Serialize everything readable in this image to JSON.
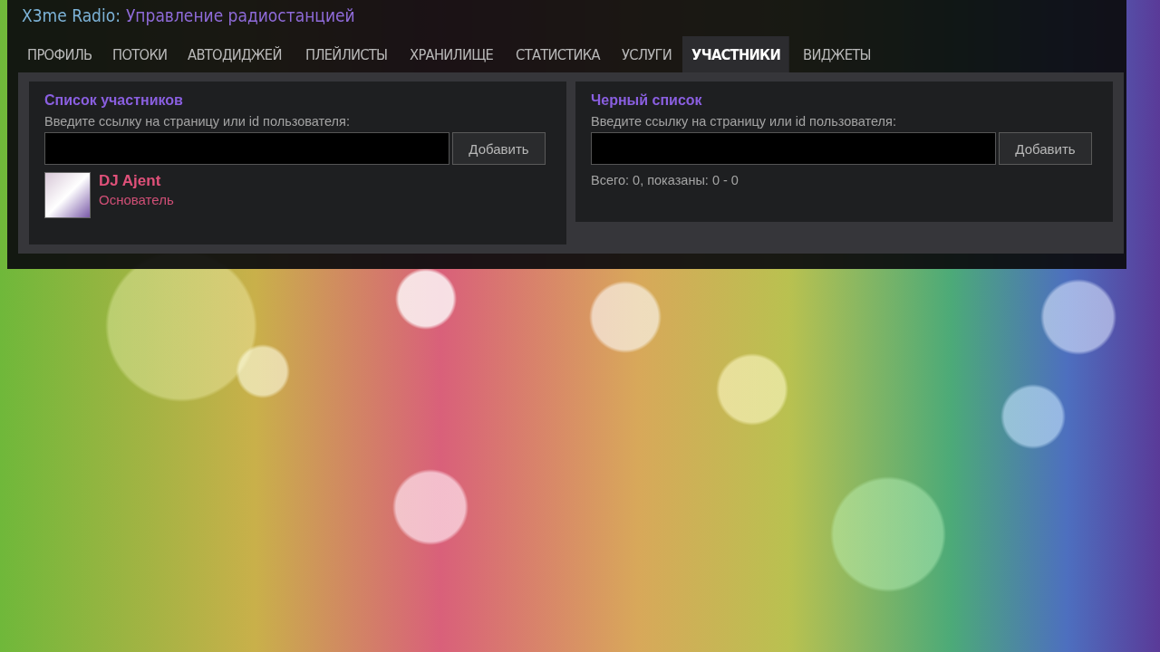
{
  "header": {
    "brand": "X3me Radio:",
    "title": "Управление радиостанцией"
  },
  "tabs": [
    {
      "label": "ПРОФИЛЬ",
      "selected": false
    },
    {
      "label": "ПОТОКИ",
      "selected": false
    },
    {
      "label": "АВТОДИДЖЕЙ",
      "selected": false
    },
    {
      "label": "ПЛЕЙЛИСТЫ",
      "selected": false
    },
    {
      "label": "ХРАНИЛИЩЕ",
      "selected": false
    },
    {
      "label": "СТАТИСТИКА",
      "selected": false
    },
    {
      "label": "УСЛУГИ",
      "selected": false
    },
    {
      "label": "УЧАСТНИКИ",
      "selected": true
    },
    {
      "label": "ВИДЖЕТЫ",
      "selected": false
    }
  ],
  "members": {
    "title": "Список участников",
    "prompt": "Введите ссылку на страницу или id пользователя:",
    "button": "Добавить",
    "items": [
      {
        "name": "DJ Ajent",
        "role": "Основатель"
      }
    ]
  },
  "blacklist": {
    "title": "Черный список",
    "prompt": "Введите ссылку на страницу или id пользователя:",
    "button": "Добавить",
    "summary": "Всего: 0, показаны: 0 - 0"
  }
}
